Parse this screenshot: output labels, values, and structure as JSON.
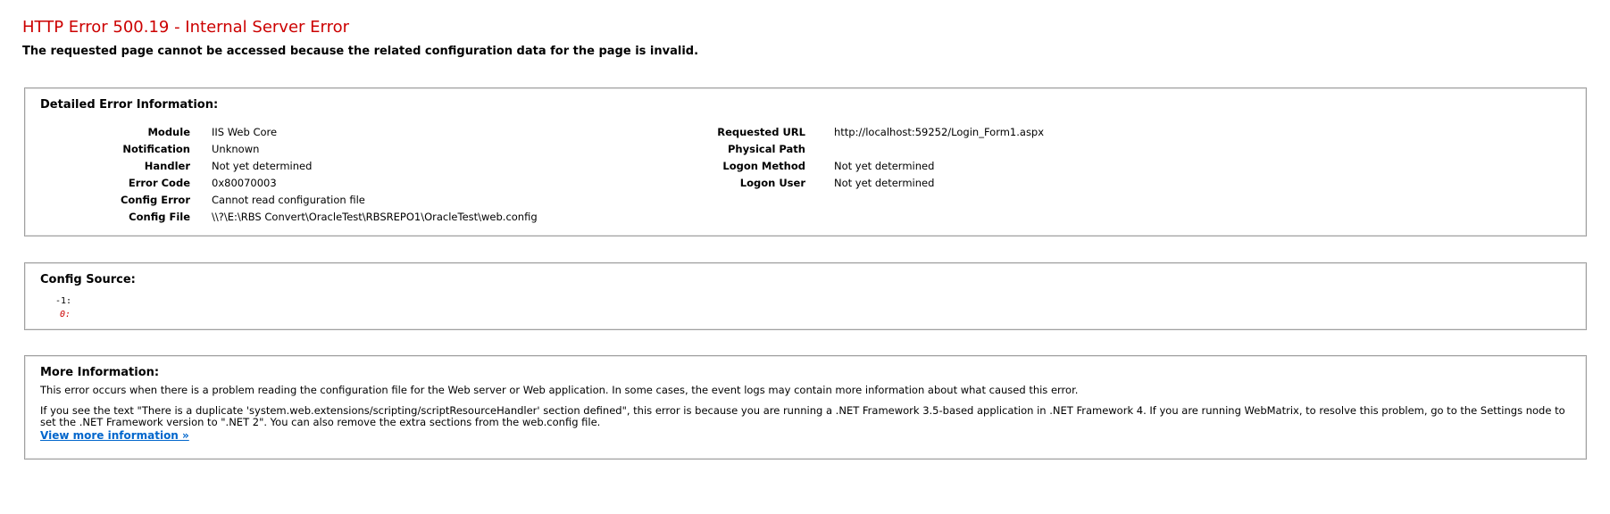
{
  "header": {
    "title": "HTTP Error 500.19 - Internal Server Error",
    "subtitle": "The requested page cannot be accessed because the related configuration data for the page is invalid."
  },
  "details": {
    "heading": "Detailed Error Information:",
    "left": [
      {
        "key": "Module",
        "value": "IIS Web Core"
      },
      {
        "key": "Notification",
        "value": "Unknown"
      },
      {
        "key": "Handler",
        "value": "Not yet determined"
      },
      {
        "key": "Error Code",
        "value": "0x80070003"
      },
      {
        "key": "Config Error",
        "value": "Cannot read configuration file"
      },
      {
        "key": "Config File",
        "value": "\\\\?\\E:\\RBS Convert\\OracleTest\\RBSREPO1\\OracleTest\\web.config"
      }
    ],
    "right": [
      {
        "key": "Requested URL",
        "value": "http://localhost:59252/Login_Form1.aspx"
      },
      {
        "key": "Physical Path",
        "value": ""
      },
      {
        "key": "Logon Method",
        "value": "Not yet determined"
      },
      {
        "key": "Logon User",
        "value": "Not yet determined"
      }
    ]
  },
  "config_source": {
    "heading": "Config Source:",
    "lines": [
      "-1:",
      "0:"
    ]
  },
  "more_info": {
    "heading": "More Information:",
    "paragraph1": "This error occurs when there is a problem reading the configuration file for the Web server or Web application. In some cases, the event logs may contain more information about what caused this error.",
    "paragraph2": "If you see the text \"There is a duplicate 'system.web.extensions/scripting/scriptResourceHandler' section defined\", this error is because you are running a .NET Framework 3.5-based application in .NET Framework 4. If you are running WebMatrix, to resolve this problem, go to the Settings node to set the .NET Framework version to \".NET 2\". You can also remove the extra sections from the web.config file.",
    "link": "View more information »"
  },
  "colors": {
    "title": "#cc0000",
    "link": "#0066cc",
    "border": "#a0a0a0"
  }
}
